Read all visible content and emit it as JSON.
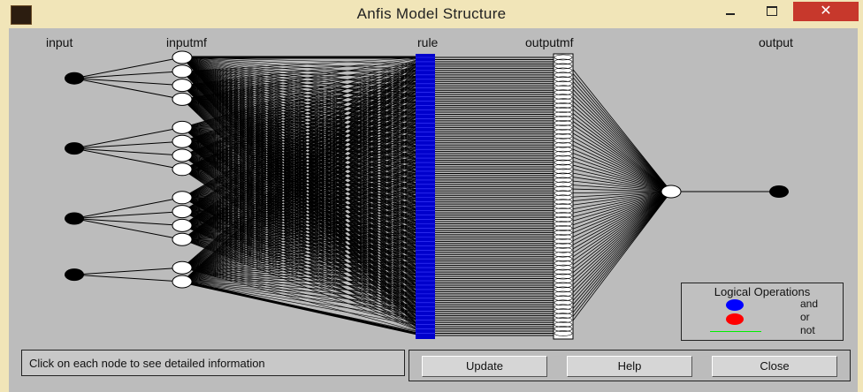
{
  "window": {
    "title": "Anfis Model Structure",
    "close_glyph": "✕"
  },
  "layers": {
    "input": "input",
    "inputmf": "inputmf",
    "rule": "rule",
    "outputmf": "outputmf",
    "output": "output"
  },
  "network": {
    "inputs": 4,
    "mfs_per_input": [
      4,
      4,
      4,
      2
    ],
    "rules": 128,
    "outputmfs": 128,
    "outputs": 1
  },
  "legend": {
    "title": "Logical Operations",
    "and": "and",
    "or": "or",
    "not": "not",
    "colors": {
      "and": "#0000ff",
      "or": "#ff0000",
      "not": "#00ee00"
    }
  },
  "status_text": "Click on each node to see detailed information",
  "buttons": {
    "update": "Update",
    "help": "Help",
    "close": "Close"
  },
  "colors": {
    "background": "#bcbcbc",
    "titlebar": "#f1e5b8",
    "close_button": "#c7382c"
  }
}
